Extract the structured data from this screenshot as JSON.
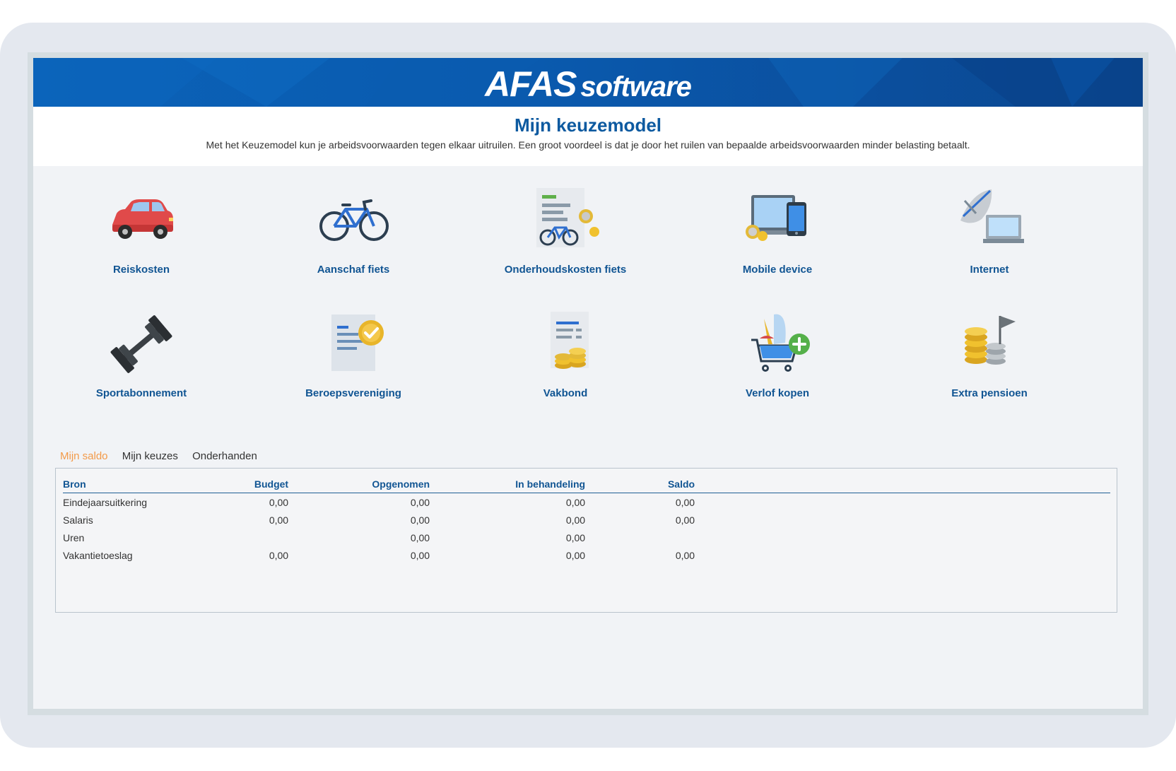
{
  "brand": {
    "logo_main": "AFAS",
    "logo_sub": "software"
  },
  "page": {
    "title": "Mijn keuzemodel",
    "description": "Met het Keuzemodel kun je arbeidsvoorwaarden tegen elkaar uitruilen. Een groot voordeel is dat je door het ruilen van bepaalde arbeidsvoorwaarden minder belasting betaalt."
  },
  "options": [
    {
      "label": "Reiskosten",
      "icon": "car-icon"
    },
    {
      "label": "Aanschaf fiets",
      "icon": "bicycle-icon"
    },
    {
      "label": "Onderhoudskosten fiets",
      "icon": "bicycle-maintenance-icon"
    },
    {
      "label": "Mobile device",
      "icon": "mobile-device-icon"
    },
    {
      "label": "Internet",
      "icon": "internet-icon"
    },
    {
      "label": "Sportabonnement",
      "icon": "dumbbell-icon"
    },
    {
      "label": "Beroepsvereniging",
      "icon": "certificate-icon"
    },
    {
      "label": "Vakbond",
      "icon": "union-coins-icon"
    },
    {
      "label": "Verlof kopen",
      "icon": "shopping-cart-icon"
    },
    {
      "label": "Extra pensioen",
      "icon": "coins-flag-icon"
    }
  ],
  "tabs": {
    "saldo": "Mijn saldo",
    "keuzes": "Mijn keuzes",
    "onderhanden": "Onderhanden",
    "active": "saldo"
  },
  "table": {
    "headers": [
      "Bron",
      "Budget",
      "Opgenomen",
      "In behandeling",
      "Saldo"
    ],
    "rows": [
      [
        "Eindejaarsuitkering",
        "0,00",
        "0,00",
        "0,00",
        "0,00"
      ],
      [
        "Salaris",
        "0,00",
        "0,00",
        "0,00",
        "0,00"
      ],
      [
        "Uren",
        "",
        "0,00",
        "0,00",
        ""
      ],
      [
        "Vakantietoeslag",
        "0,00",
        "0,00",
        "0,00",
        "0,00"
      ]
    ]
  },
  "colors": {
    "banner": "#0b5fb3",
    "title": "#0d5aa0",
    "link": "#115593",
    "active_tab": "#f39a48"
  }
}
